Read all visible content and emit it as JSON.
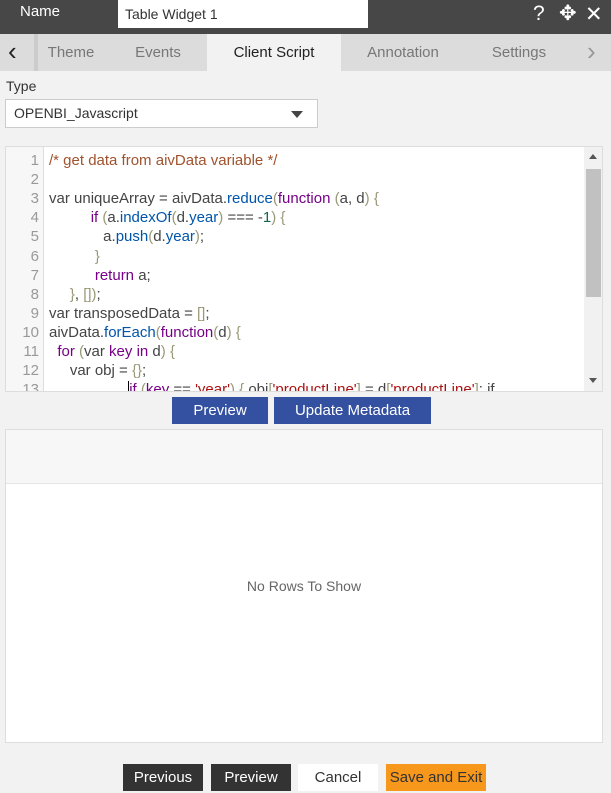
{
  "header": {
    "name_label": "Name",
    "widget_name": "Table Widget 1",
    "icons": [
      "help-icon",
      "move-icon",
      "close-icon"
    ]
  },
  "tabs": [
    {
      "label": "Theme"
    },
    {
      "label": "Events"
    },
    {
      "label": "Client Script",
      "active": true
    },
    {
      "label": "Annotation"
    },
    {
      "label": "Settings"
    }
  ],
  "type": {
    "label": "Type",
    "value": "OPENBI_Javascript"
  },
  "editor": {
    "lines": [
      [
        [
          "cm",
          "/* get data from aivData variable */"
        ]
      ],
      [],
      [
        [
          "tx",
          "var uniqueArray = aivData."
        ],
        [
          "pr",
          "reduce"
        ],
        [
          "br",
          "("
        ],
        [
          "kw",
          "function"
        ],
        [
          "br",
          " ("
        ],
        [
          "tx",
          "a, d"
        ],
        [
          "br",
          ")"
        ],
        [
          "tx",
          " "
        ],
        [
          "br",
          "{"
        ]
      ],
      [
        [
          "tx",
          "          "
        ],
        [
          "kw",
          "if"
        ],
        [
          "br",
          " ("
        ],
        [
          "tx",
          "a."
        ],
        [
          "pr",
          "indexOf"
        ],
        [
          "br",
          "("
        ],
        [
          "tx",
          "d."
        ],
        [
          "pr",
          "year"
        ],
        [
          "br",
          ")"
        ],
        [
          "tx",
          " === -"
        ],
        [
          "nu",
          "1"
        ],
        [
          "br",
          ")"
        ],
        [
          "tx",
          " "
        ],
        [
          "br",
          "{"
        ]
      ],
      [
        [
          "tx",
          "             a."
        ],
        [
          "pr",
          "push"
        ],
        [
          "br",
          "("
        ],
        [
          "tx",
          "d."
        ],
        [
          "pr",
          "year"
        ],
        [
          "br",
          ")"
        ],
        [
          "tx",
          ";"
        ]
      ],
      [
        [
          "tx",
          "           "
        ],
        [
          "br",
          "}"
        ]
      ],
      [
        [
          "tx",
          "           "
        ],
        [
          "kw",
          "return"
        ],
        [
          "tx",
          " a;"
        ]
      ],
      [
        [
          "tx",
          "     "
        ],
        [
          "br",
          "}"
        ],
        [
          "tx",
          ", "
        ],
        [
          "br",
          "[]"
        ],
        [
          "br",
          ")"
        ],
        [
          "tx",
          ";"
        ]
      ],
      [
        [
          "tx",
          "var transposedData = "
        ],
        [
          "br",
          "[]"
        ],
        [
          "tx",
          ";"
        ]
      ],
      [
        [
          "tx",
          "aivData."
        ],
        [
          "pr",
          "forEach"
        ],
        [
          "br",
          "("
        ],
        [
          "kw",
          "function"
        ],
        [
          "br",
          "("
        ],
        [
          "tx",
          "d"
        ],
        [
          "br",
          ")"
        ],
        [
          "tx",
          " "
        ],
        [
          "br",
          "{"
        ]
      ],
      [
        [
          "tx",
          "  "
        ],
        [
          "kw",
          "for"
        ],
        [
          "br",
          " ("
        ],
        [
          "tx",
          "var "
        ],
        [
          "kw",
          "key"
        ],
        [
          "tx",
          " "
        ],
        [
          "kw",
          "in"
        ],
        [
          "tx",
          " d"
        ],
        [
          "br",
          ")"
        ],
        [
          "tx",
          " "
        ],
        [
          "br",
          "{"
        ]
      ],
      [
        [
          "tx",
          "     var obj = "
        ],
        [
          "br",
          "{}"
        ],
        [
          "tx",
          ";"
        ]
      ],
      [
        [
          "tx",
          "                   "
        ],
        [
          "cur",
          ""
        ],
        [
          "kw",
          "if"
        ],
        [
          "br",
          " ("
        ],
        [
          "kw",
          "key"
        ],
        [
          "tx",
          " == "
        ],
        [
          "st",
          "'year'"
        ],
        [
          "br",
          ")"
        ],
        [
          "tx",
          " "
        ],
        [
          "br",
          "{"
        ],
        [
          "tx",
          " obj"
        ],
        [
          "br",
          "["
        ],
        [
          "st",
          "'productLine'"
        ],
        [
          "br",
          "]"
        ],
        [
          "tx",
          " = d"
        ],
        [
          "br",
          "["
        ],
        [
          "st",
          "'productLine'"
        ],
        [
          "br",
          "]"
        ],
        [
          "tx",
          "; if"
        ]
      ]
    ]
  },
  "buttons": {
    "preview": "Preview",
    "update_metadata": "Update Metadata",
    "previous": "Previous",
    "preview2": "Preview",
    "cancel": "Cancel",
    "save_exit": "Save and Exit"
  },
  "grid": {
    "empty_text": "No Rows To Show"
  },
  "colors": {
    "header": "#474747",
    "primary": "#3450a0",
    "save": "#f7981c",
    "dark_button": "#333333"
  }
}
